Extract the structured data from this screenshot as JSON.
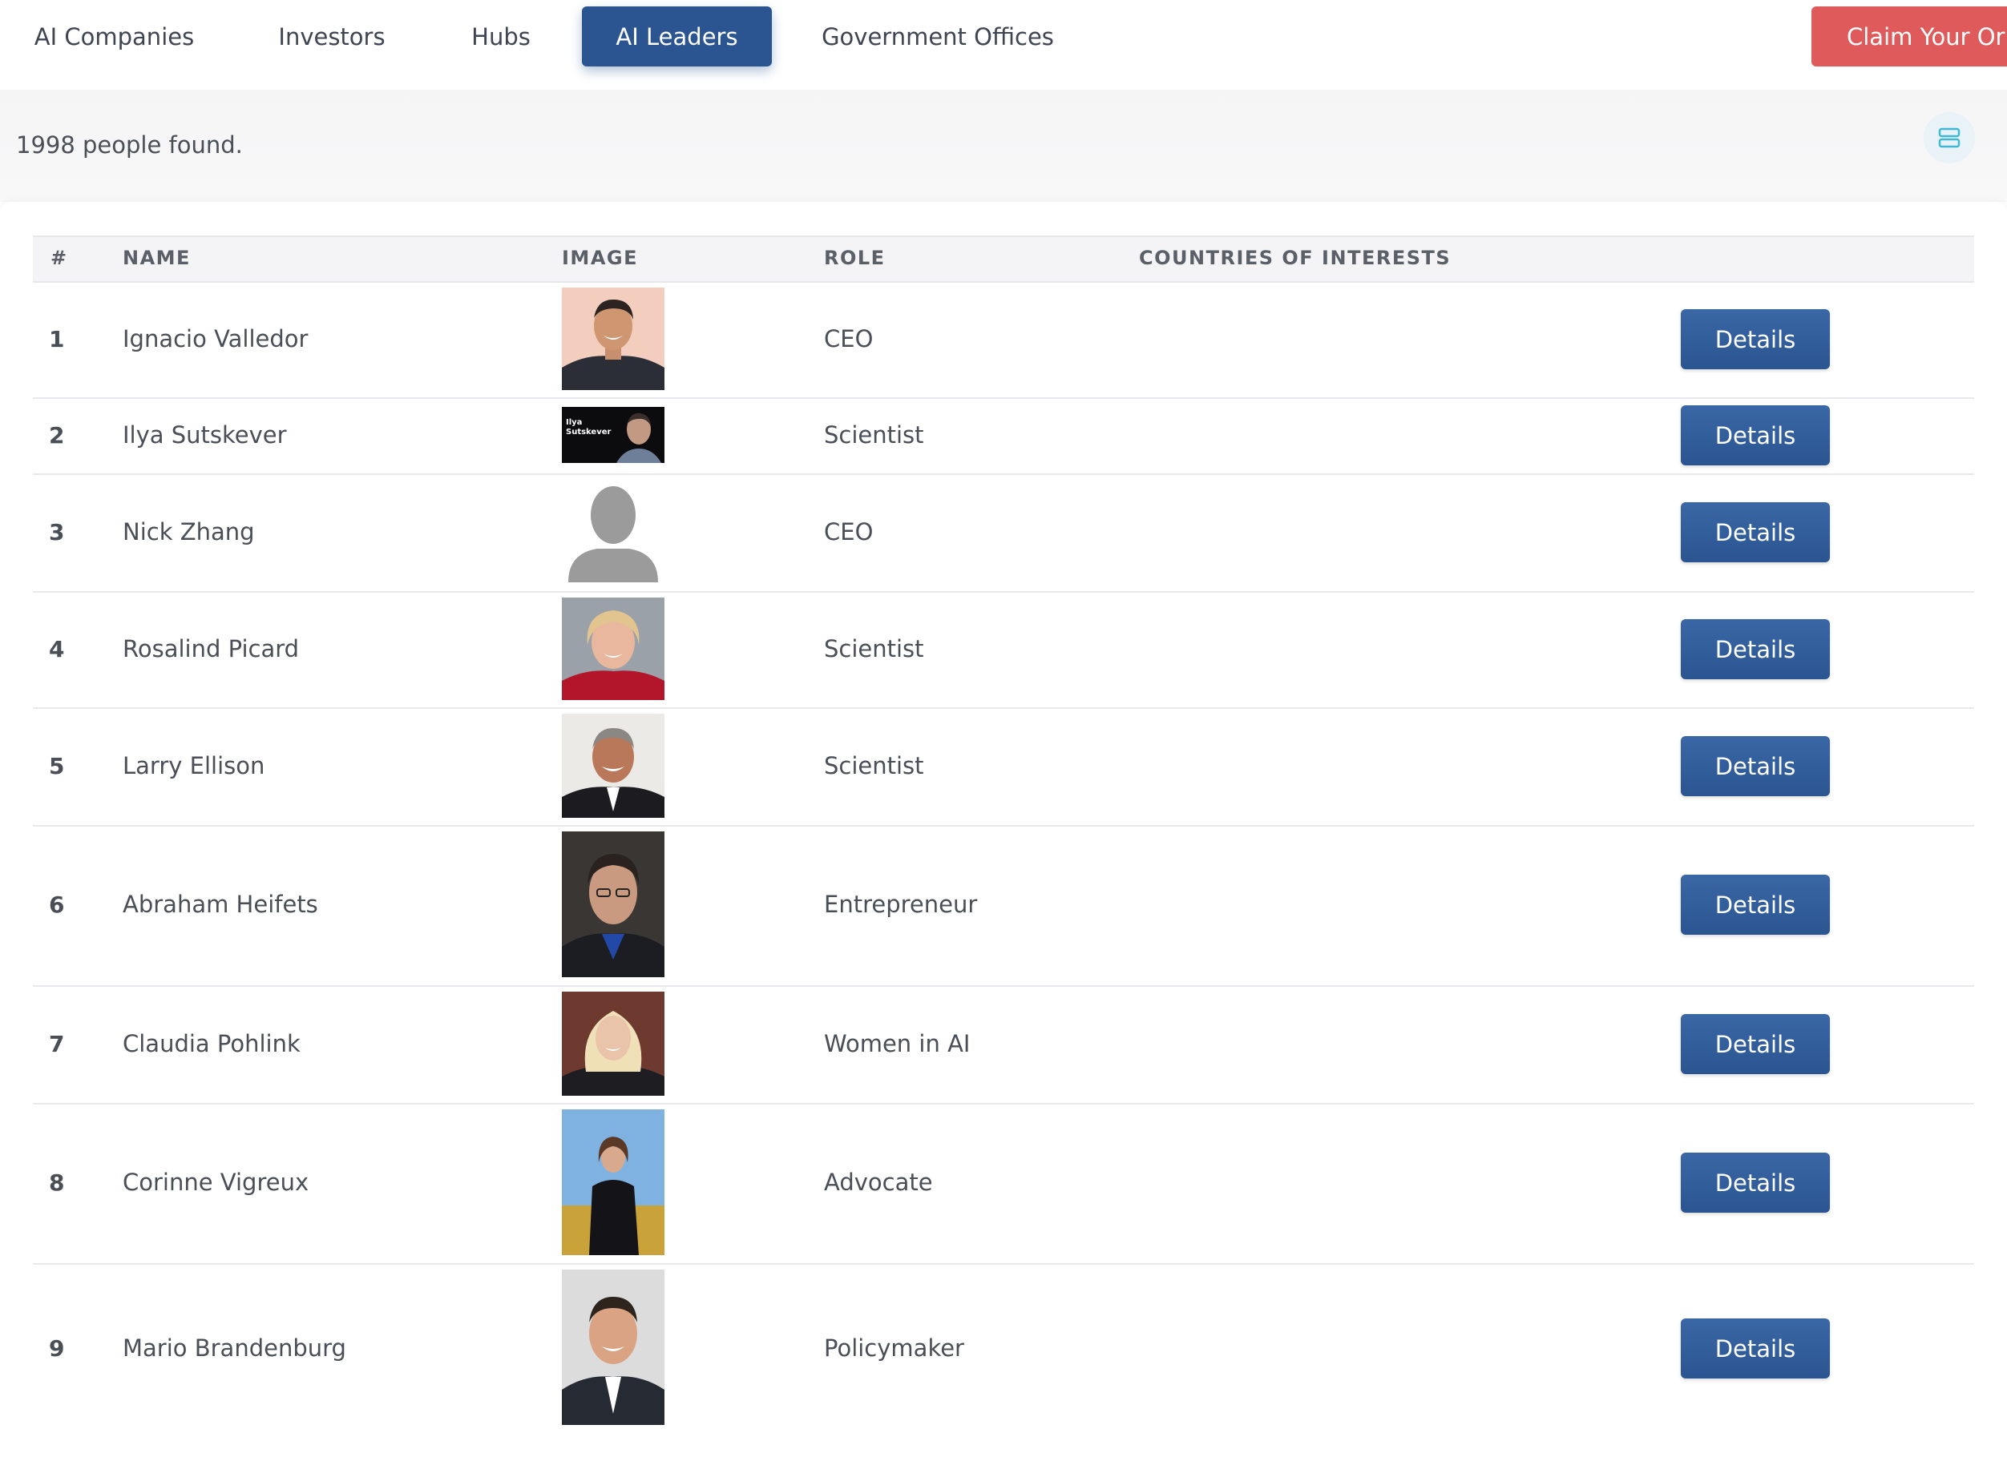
{
  "nav": {
    "tabs": [
      {
        "label": "AI Companies"
      },
      {
        "label": "Investors"
      },
      {
        "label": "Hubs"
      },
      {
        "label": "AI Leaders"
      },
      {
        "label": "Government Offices"
      }
    ],
    "active_tab": "AI Leaders",
    "claim_button": "Claim Your Or"
  },
  "summary": {
    "count_text": "1998 people found.",
    "view_toggle_icon": "list-view-icon"
  },
  "table": {
    "headers": {
      "num": "#",
      "name": "NAME",
      "image": "IMAGE",
      "role": "ROLE",
      "countries": "COUNTRIES OF INTERESTS"
    },
    "rows": [
      {
        "num": "1",
        "name": "Ignacio Valledor",
        "role": "CEO",
        "action": "Details"
      },
      {
        "num": "2",
        "name": "Ilya Sutskever",
        "role": "Scientist",
        "action": "Details",
        "image_caption": "Ilya Sutskever"
      },
      {
        "num": "3",
        "name": "Nick Zhang",
        "role": "CEO",
        "action": "Details"
      },
      {
        "num": "4",
        "name": "Rosalind Picard",
        "role": "Scientist",
        "action": "Details"
      },
      {
        "num": "5",
        "name": "Larry Ellison",
        "role": "Scientist",
        "action": "Details"
      },
      {
        "num": "6",
        "name": "Abraham Heifets",
        "role": "Entrepreneur",
        "action": "Details"
      },
      {
        "num": "7",
        "name": "Claudia Pohlink",
        "role": "Women in AI",
        "action": "Details"
      },
      {
        "num": "8",
        "name": "Corinne Vigreux",
        "role": "Advocate",
        "action": "Details"
      },
      {
        "num": "9",
        "name": "Mario Brandenburg",
        "role": "Policymaker",
        "action": "Details"
      }
    ]
  },
  "colors": {
    "primary": "#2a5591",
    "claim": "#df5b5b",
    "toggle_icon": "#3fb8d6"
  }
}
